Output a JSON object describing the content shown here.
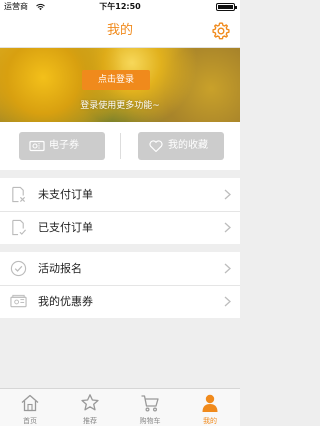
{
  "status_bar": {
    "carrier": "运营商",
    "time": "下午12:50"
  },
  "nav": {
    "title": "我的",
    "settings_icon": "gear-icon"
  },
  "banner": {
    "login_button": "点击登录",
    "login_hint": "登录使用更多功能~"
  },
  "quick_actions": [
    {
      "label": "电子券",
      "icon": "ticket-icon"
    },
    {
      "label": "我的收藏",
      "icon": "heart-icon"
    }
  ],
  "orders": [
    {
      "label": "未支付订单",
      "icon": "document-x-icon"
    },
    {
      "label": "已支付订单",
      "icon": "document-check-icon"
    }
  ],
  "activities": [
    {
      "label": "活动报名",
      "icon": "check-circle-icon"
    },
    {
      "label": "我的优惠券",
      "icon": "coupon-icon"
    }
  ],
  "tabs": [
    {
      "label": "首页",
      "icon": "home-icon"
    },
    {
      "label": "推荐",
      "icon": "star-icon"
    },
    {
      "label": "购物车",
      "icon": "cart-icon"
    },
    {
      "label": "我的",
      "icon": "person-icon"
    }
  ],
  "colors": {
    "accent": "#f08a1c",
    "background": "#eeeeee",
    "quick_button": "#cccccc",
    "tab_inactive": "#888888"
  }
}
